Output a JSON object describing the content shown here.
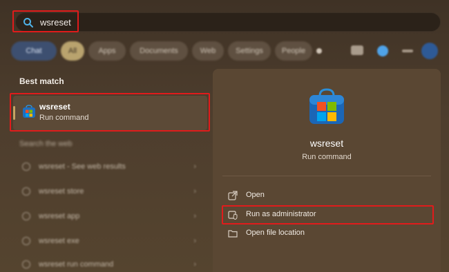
{
  "search": {
    "query": "wsreset"
  },
  "filters": {
    "chips": [
      "Chat",
      "All",
      "Apps",
      "Documents",
      "Web",
      "Settings",
      "People"
    ]
  },
  "left": {
    "best_match_heading": "Best match",
    "best_match": {
      "name": "wsreset",
      "type": "Run command"
    },
    "web_heading": "Search the web",
    "suggestions": [
      "wsreset - See web results",
      "wsreset store",
      "wsreset app",
      "wsreset exe",
      "wsreset run command"
    ]
  },
  "right": {
    "app_name": "wsreset",
    "app_type": "Run command",
    "actions": [
      {
        "label": "Open",
        "icon": "open-icon"
      },
      {
        "label": "Run as administrator",
        "icon": "shield-icon"
      },
      {
        "label": "Open file location",
        "icon": "folder-icon"
      }
    ]
  },
  "colors": {
    "highlight": "#e11b1b",
    "accent": "#c7a463",
    "panel": "#5a4733"
  }
}
